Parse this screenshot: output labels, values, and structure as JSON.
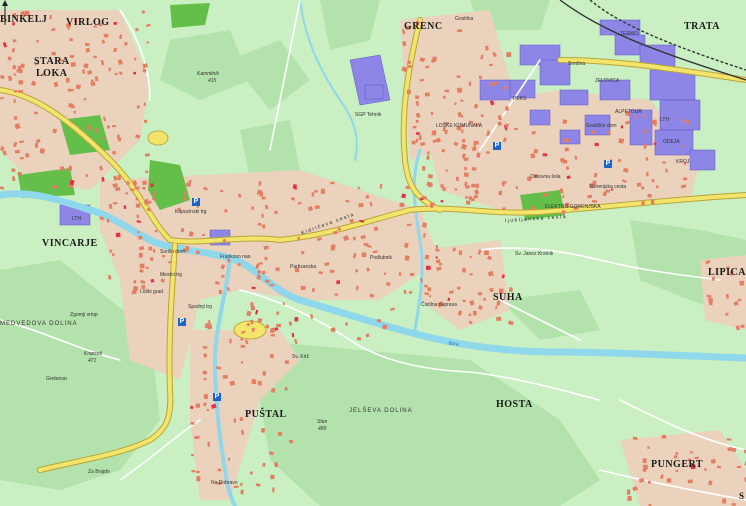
{
  "map": {
    "colors": {
      "land": "#c9efc3",
      "forest": "#b4e2ac",
      "builtup": "#e9c7b0",
      "building": "#e37e62",
      "industry": "#8d86e6",
      "public": "#e0334a",
      "park": "#64bf4a",
      "mainRoad": "#f3e46c",
      "river": "#8fd8ec",
      "railway": "#333333"
    },
    "places": [
      {
        "id": "binkelj",
        "name": "BINKELJ"
      },
      {
        "id": "virlog",
        "name": "VIRLOG"
      },
      {
        "id": "stara",
        "name": "STARA"
      },
      {
        "id": "loka",
        "name": "LOKA"
      },
      {
        "id": "vincarje",
        "name": "VINCARJE"
      },
      {
        "id": "grenc",
        "name": "GRENC"
      },
      {
        "id": "trata",
        "name": "TRATA"
      },
      {
        "id": "suha",
        "name": "SUHA"
      },
      {
        "id": "lipica",
        "name": "LIPICA"
      },
      {
        "id": "pustal",
        "name": "PUŠTAL"
      },
      {
        "id": "hosta",
        "name": "HOSTA"
      },
      {
        "id": "pungert",
        "name": "PUNGERT"
      }
    ],
    "features": [
      {
        "id": "medvedova",
        "name": "MEDVEDOVA DOLINA"
      },
      {
        "id": "jelseva",
        "name": "JELŠEVA DOLINA"
      }
    ],
    "peaks": [
      {
        "id": "kamnitnik",
        "name": "Kamnitnik",
        "elevation": "415"
      },
      {
        "id": "krancelj",
        "name": "Kranceli",
        "elevation": "471"
      },
      {
        "id": "sten",
        "name": "Sten",
        "elevation": "489"
      }
    ],
    "roads": [
      {
        "id": "ljubljanska",
        "name": "ljubljanska cesta"
      },
      {
        "id": "kidriceva",
        "name": "Kidričeva cesta"
      },
      {
        "id": "kapuc",
        "name": "Kapucinski trg"
      }
    ],
    "rivers": [
      {
        "id": "sora",
        "name": "Sora"
      }
    ],
    "streetLabels": [
      {
        "id": "s1",
        "name": "Frankovo nas."
      },
      {
        "id": "s2",
        "name": "Partizanska"
      },
      {
        "id": "s3",
        "name": "Podlubnik"
      },
      {
        "id": "s4",
        "name": "Sv. Janez Krstnik"
      },
      {
        "id": "s5",
        "name": "Čistilna naprava"
      },
      {
        "id": "s6",
        "name": "Sv. Križ"
      },
      {
        "id": "s7",
        "name": "Gostilna"
      },
      {
        "id": "s8",
        "name": "Loški grad"
      },
      {
        "id": "s9",
        "name": "Grebenar"
      },
      {
        "id": "s10",
        "name": "Zgornji vrtop"
      },
      {
        "id": "s11",
        "name": "Za Brajdo"
      },
      {
        "id": "s12",
        "name": "Na Dobravo"
      },
      {
        "id": "s13",
        "name": "SGP Tehnik"
      },
      {
        "id": "s14",
        "name": "Sredina"
      },
      {
        "id": "s15",
        "name": "JELOVICA"
      },
      {
        "id": "s16",
        "name": "PEKS"
      },
      {
        "id": "s17",
        "name": "LTH"
      },
      {
        "id": "s18",
        "name": "TERMO"
      },
      {
        "id": "s19",
        "name": "ODEJA"
      },
      {
        "id": "s20",
        "name": "KROJ"
      },
      {
        "id": "s21",
        "name": "LOŠKE KOMUNALA"
      },
      {
        "id": "s22",
        "name": "Gostišče dom"
      },
      {
        "id": "s23",
        "name": "ALPETOUR"
      },
      {
        "id": "s24",
        "name": "ELEKTRO GORENJSKA"
      },
      {
        "id": "s25",
        "name": "Osnovna šola"
      },
      {
        "id": "s26",
        "name": "Gorenjska cesta"
      },
      {
        "id": "s27",
        "name": "LTH"
      },
      {
        "id": "s28",
        "name": "Sorški dom"
      },
      {
        "id": "s29",
        "name": "Spodnji trg"
      },
      {
        "id": "s30",
        "name": "Mestni trg"
      }
    ],
    "compass": "S"
  }
}
